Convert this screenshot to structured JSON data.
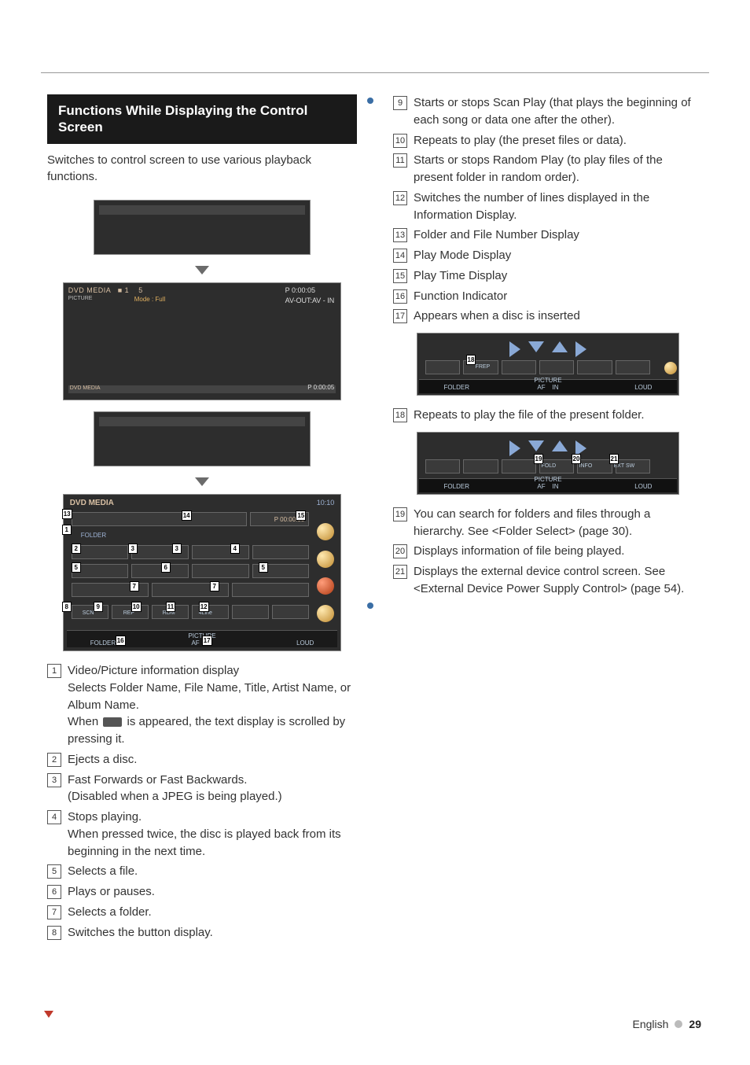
{
  "section": {
    "title": "Functions While Displaying the Control Screen",
    "intro": "Switches to control screen to use various playback functions."
  },
  "figures": {
    "dvd_header": "DVD MEDIA",
    "playback_info_left": "DVD MEDIA",
    "playback_sub": "PICTURE",
    "playback_track": "1",
    "playback_file": "5",
    "playback_mode_label": "Mode : Full",
    "playback_time": "P  0:00:05",
    "playback_avout": "AV-OUT:AV - IN",
    "clock": "10:10",
    "p_time": "P    00:00:05",
    "folder_label": "FOLDER",
    "status_af": "AF",
    "status_in": "IN",
    "status_picture": "PICTURE",
    "status_loud": "LOUD",
    "btn_scn": "SCN",
    "btn_rep": "REP",
    "btn_rdm": "RDM",
    "btn_4line": "4Line",
    "btn_frep": "FREP",
    "btn_fold": "FOLD",
    "btn_info": "INFO",
    "btn_extsw": "EXT SW"
  },
  "left_items": [
    {
      "n": "1",
      "text": "Video/Picture information display\nSelects Folder Name, File Name, Title, Artist Name, or Album Name.\nWhen {scroll} is appeared, the text display is scrolled by pressing it."
    },
    {
      "n": "2",
      "text": "Ejects a disc."
    },
    {
      "n": "3",
      "text": "Fast Forwards or Fast Backwards.\n(Disabled when a JPEG is being played.)"
    },
    {
      "n": "4",
      "text": "Stops playing.\nWhen pressed twice, the disc is played back from its beginning in the next time."
    },
    {
      "n": "5",
      "text": "Selects a file."
    },
    {
      "n": "6",
      "text": "Plays or pauses."
    },
    {
      "n": "7",
      "text": "Selects a folder."
    },
    {
      "n": "8",
      "text": "Switches the button display."
    }
  ],
  "right_items_a": [
    {
      "n": "9",
      "text": "Starts or stops Scan Play (that plays the beginning of each song or data one after the other)."
    },
    {
      "n": "10",
      "text": "Repeats to play (the preset files or data)."
    },
    {
      "n": "11",
      "text": "Starts or stops Random Play (to play files of the present folder in random order)."
    },
    {
      "n": "12",
      "text": "Switches the number of lines displayed in the Information Display."
    },
    {
      "n": "13",
      "text": "Folder and File Number Display"
    },
    {
      "n": "14",
      "text": "Play Mode Display"
    },
    {
      "n": "15",
      "text": "Play Time Display"
    },
    {
      "n": "16",
      "text": "Function Indicator"
    },
    {
      "n": "17",
      "text": "Appears when a disc is inserted"
    }
  ],
  "right_items_b": [
    {
      "n": "18",
      "text": "Repeats to play the file of the present folder."
    }
  ],
  "right_items_c": [
    {
      "n": "19",
      "text": "You can search for folders and files through a hierarchy. See <Folder Select> (page 30)."
    },
    {
      "n": "20",
      "text": "Displays information of file being played."
    },
    {
      "n": "21",
      "text": "Displays the external device control screen. See <External Device Power Supply Control> (page 54)."
    }
  ],
  "footer": {
    "language": "English",
    "page": "29"
  }
}
